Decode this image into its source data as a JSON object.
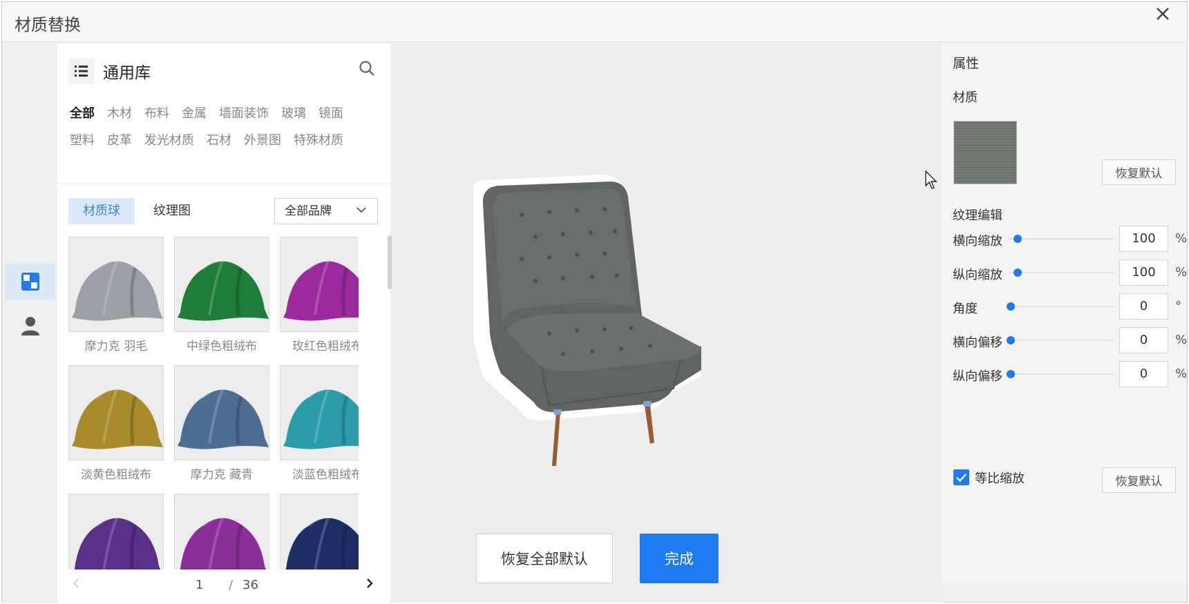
{
  "dialog": {
    "title": "材质替换"
  },
  "library": {
    "name": "通用库",
    "categories": [
      "全部",
      "木材",
      "布料",
      "金属",
      "墙面装饰",
      "玻璃",
      "镜面",
      "塑料",
      "皮革",
      "发光材质",
      "石材",
      "外景图",
      "特殊材质"
    ],
    "tabs": [
      "材质球",
      "纹理图"
    ],
    "brand_select": "全部品牌",
    "materials": [
      {
        "name": "摩力克 羽毛",
        "color": "#9aa0a6"
      },
      {
        "name": "中绿色粗绒布",
        "color": "#1f7d3a"
      },
      {
        "name": "玫红色粗绒布",
        "color": "#9c2a9e"
      },
      {
        "name": "淡黄色粗绒布",
        "color": "#a88b2a"
      },
      {
        "name": "摩力克 藏青",
        "color": "#4d6e91"
      },
      {
        "name": "淡蓝色粗绒布",
        "color": "#2b9ba7"
      },
      {
        "name": "",
        "color": "#5a2f8a"
      },
      {
        "name": "",
        "color": "#8a2e98"
      },
      {
        "name": "",
        "color": "#1e2f66"
      }
    ],
    "pager": {
      "current": "1",
      "separator": "/",
      "total": "36"
    }
  },
  "viewport": {
    "reset_all": "恢复全部默认",
    "done": "完成"
  },
  "properties": {
    "title": "属性",
    "material_label": "材质",
    "reset_default": "恢复默认",
    "texture_label": "纹理编辑",
    "rows": [
      {
        "label": "横向缩放",
        "value": "100",
        "unit": "%"
      },
      {
        "label": "纵向缩放",
        "value": "100",
        "unit": "%"
      },
      {
        "label": "角度",
        "value": "0",
        "unit": "°"
      },
      {
        "label": "横向偏移",
        "value": "0",
        "unit": "%"
      },
      {
        "label": "纵向偏移",
        "value": "0",
        "unit": "%"
      }
    ],
    "proportional_label": "等比缩放",
    "proportional_checked": true,
    "reset_default_2": "恢复默认"
  },
  "colors": {
    "accent": "#1e7cf0",
    "chair": "#5f6560",
    "leg": "#9a5a32"
  }
}
